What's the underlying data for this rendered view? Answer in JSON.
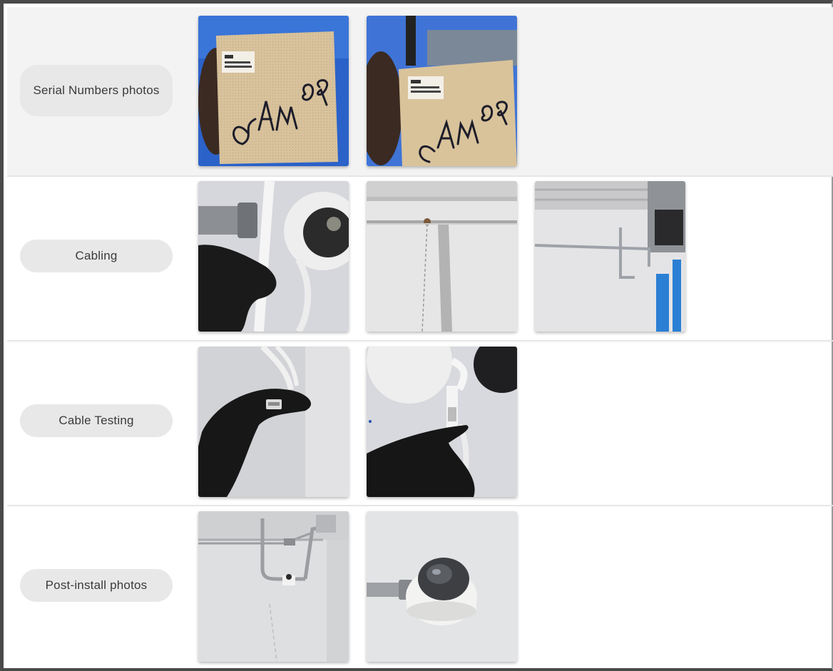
{
  "sections": [
    {
      "label": "Serial Numbers photos",
      "photos": [
        {
          "icon": "photo-serial-box-front",
          "handwriting": "CAm 08"
        },
        {
          "icon": "photo-serial-box-angle",
          "handwriting": "CAm 08"
        }
      ]
    },
    {
      "label": "Cabling",
      "photos": [
        {
          "icon": "photo-cable-connector"
        },
        {
          "icon": "photo-wall-conduit"
        },
        {
          "icon": "photo-ceiling-conduit"
        }
      ]
    },
    {
      "label": "Cable Testing",
      "photos": [
        {
          "icon": "photo-rj45-plug"
        },
        {
          "icon": "photo-cable-tester"
        }
      ]
    },
    {
      "label": "Post-install photos",
      "photos": [
        {
          "icon": "photo-conduit-run"
        },
        {
          "icon": "photo-dome-camera"
        }
      ]
    }
  ],
  "colors": {
    "frame": "#4a4a4a",
    "shaded_row": "#f3f3f3",
    "pill": "#e8e8e8",
    "pill_text": "#3a3a3a"
  }
}
